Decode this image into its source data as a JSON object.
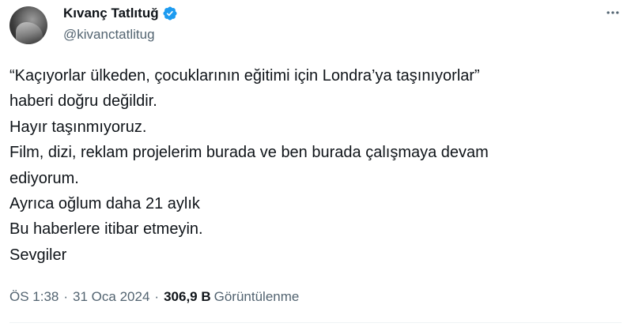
{
  "user": {
    "display_name": "Kıvanç Tatlıtuğ",
    "handle": "@kivanctatlitug",
    "verified": true
  },
  "tweet": {
    "lines": [
      "“Kaçıyorlar ülkeden, çocuklarının eğitimi için Londra’ya taşınıyorlar”",
      "haberi doğru değildir.",
      "Hayır taşınmıyoruz.",
      "Film, dizi, reklam projelerim burada ve ben burada çalışmaya devam",
      "ediyorum.",
      "Ayrıca oğlum daha 21 aylık",
      "Bu haberlere itibar etmeyin.",
      "Sevgiler"
    ]
  },
  "meta": {
    "time": "ÖS 1:38",
    "separator": "·",
    "date": "31 Oca 2024",
    "views_count": "306,9 B",
    "views_label": "Görüntülenme"
  },
  "colors": {
    "text_primary": "#0f1419",
    "text_secondary": "#536471",
    "verified_blue": "#1d9bf0",
    "divider": "#eff3f4"
  },
  "icons": {
    "verified": "verified-badge-icon",
    "more": "more-options-icon"
  }
}
